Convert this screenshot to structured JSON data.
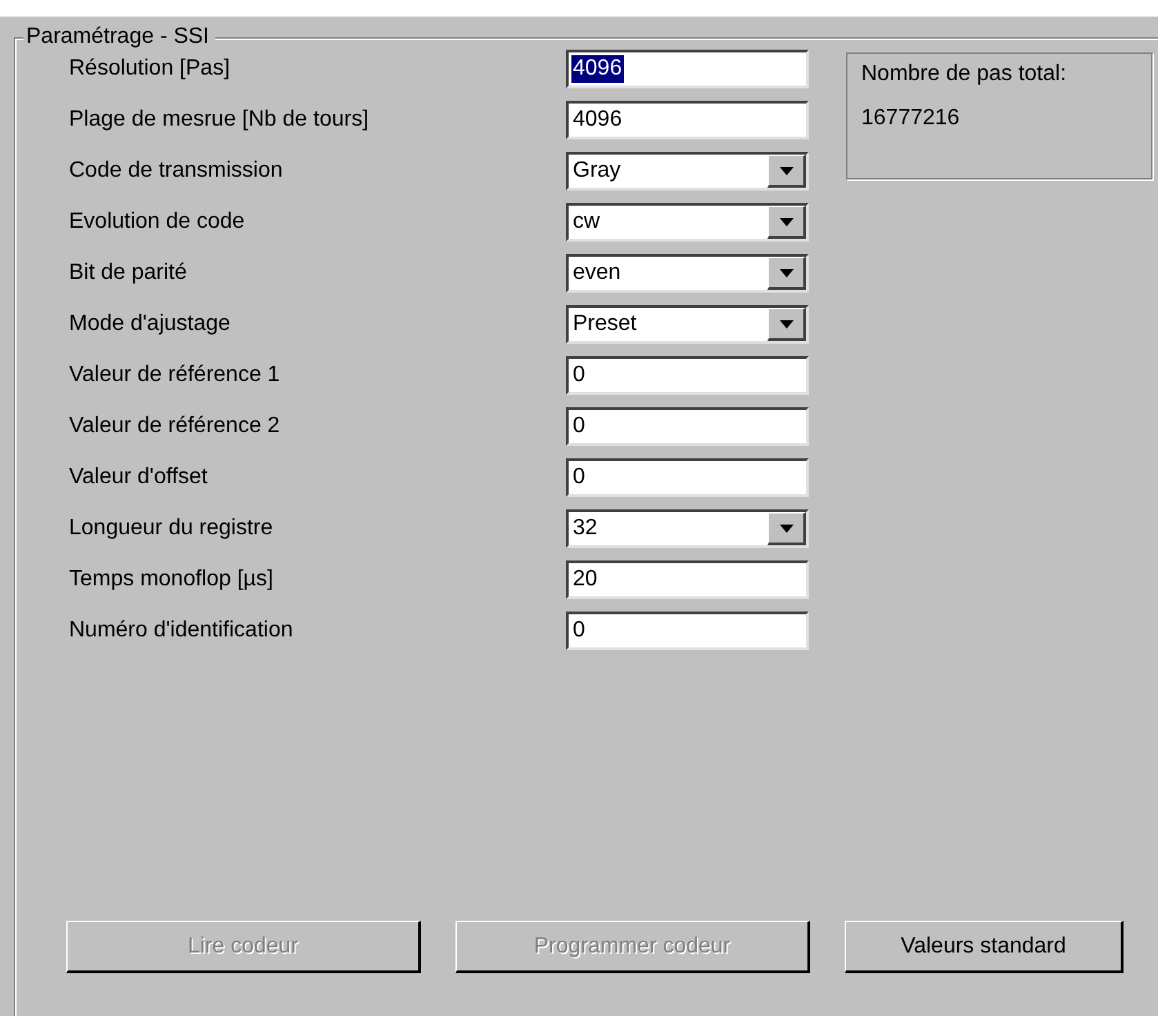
{
  "group": {
    "title": "Paramétrage - SSI"
  },
  "fields": [
    {
      "label": "Résolution [Pas]",
      "kind": "text",
      "value": "4096",
      "text_selected": true
    },
    {
      "label": "Plage de mesrue [Nb de tours]",
      "kind": "text",
      "value": "4096",
      "text_selected": false
    },
    {
      "label": "Code de transmission",
      "kind": "dropdown",
      "value": "Gray",
      "text_selected": false
    },
    {
      "label": "Evolution de code",
      "kind": "dropdown",
      "value": "cw",
      "text_selected": false
    },
    {
      "label": "Bit de parité",
      "kind": "dropdown",
      "value": "even",
      "text_selected": false
    },
    {
      "label": "Mode d'ajustage",
      "kind": "dropdown",
      "value": "Preset",
      "text_selected": false
    },
    {
      "label": "Valeur de référence 1",
      "kind": "text",
      "value": "0",
      "text_selected": false
    },
    {
      "label": "Valeur de référence 2",
      "kind": "text",
      "value": "0",
      "text_selected": false
    },
    {
      "label": "Valeur d'offset",
      "kind": "text",
      "value": "0",
      "text_selected": false
    },
    {
      "label": "Longueur du registre",
      "kind": "dropdown",
      "value": "32",
      "text_selected": false
    },
    {
      "label": "Temps monoflop [µs]",
      "kind": "text",
      "value": "20",
      "text_selected": false
    },
    {
      "label": "Numéro d'identification",
      "kind": "text",
      "value": "0",
      "text_selected": false
    }
  ],
  "info": {
    "label": "Nombre de pas total:",
    "value": "16777216"
  },
  "buttons": [
    {
      "label": "Lire codeur",
      "disabled": true
    },
    {
      "label": "Programmer codeur",
      "disabled": true
    },
    {
      "label": "Valeurs standard",
      "disabled": false
    }
  ]
}
